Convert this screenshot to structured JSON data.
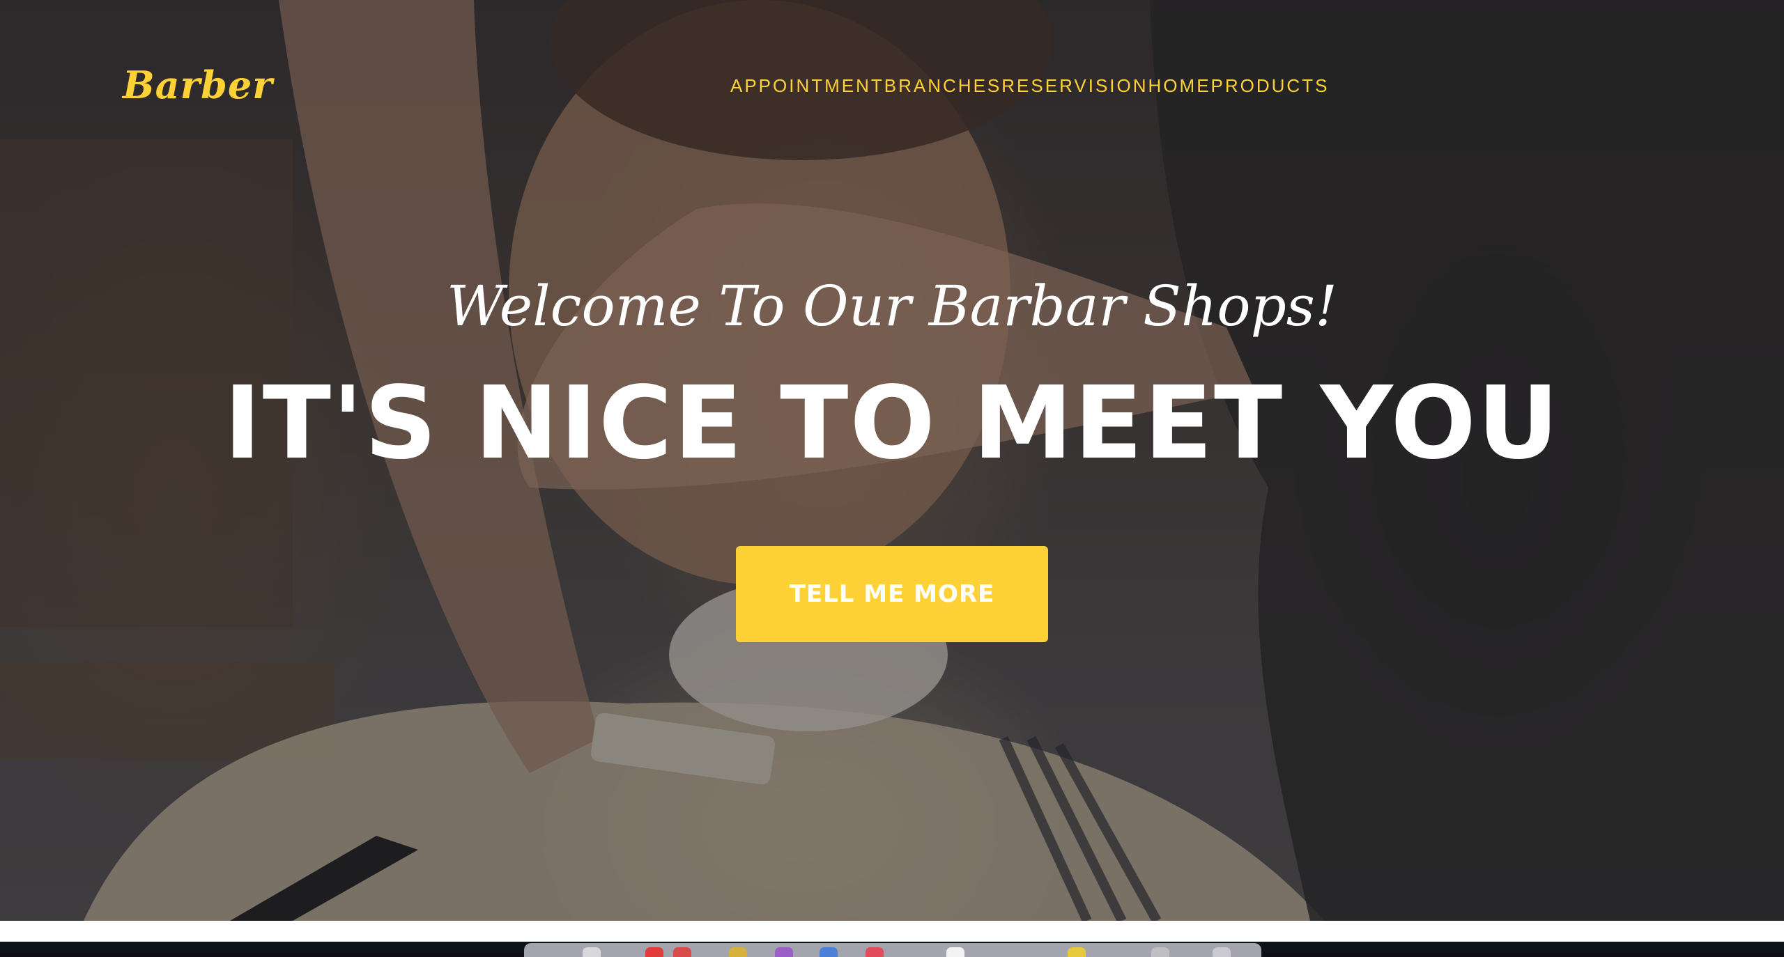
{
  "navbar": {
    "brand": "Barber",
    "links": [
      {
        "label": "APPOINTMENT"
      },
      {
        "label": "BRANCHES"
      },
      {
        "label": "RESERVISION"
      },
      {
        "label": "HOME"
      },
      {
        "label": "PRODUCTS"
      }
    ]
  },
  "hero": {
    "subheading": "Welcome To Our Barbar Shops!",
    "heading": "IT'S NICE TO MEET YOU",
    "cta_label": "TELL ME MORE",
    "background": "barber-shaving-photo"
  },
  "colors": {
    "accent": "#fed136",
    "heading_text": "#ffffff",
    "overlay": "#1c1c22"
  },
  "dock": {
    "icons": [
      "app-icon",
      "app-icon",
      "app-icon",
      "app-icon",
      "app-icon",
      "app-icon",
      "app-icon",
      "app-icon",
      "app-icon",
      "app-icon",
      "app-icon"
    ]
  }
}
